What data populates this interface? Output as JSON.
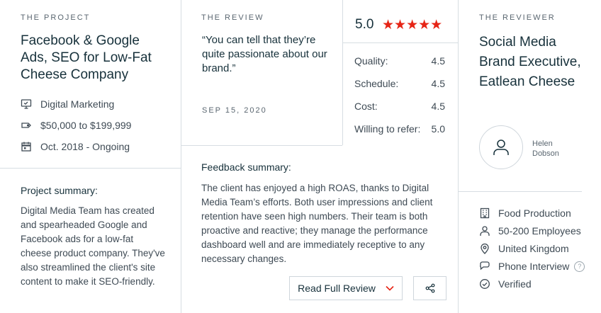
{
  "project": {
    "header": "THE PROJECT",
    "title": "Facebook & Google Ads, SEO for Low-Fat Cheese Company",
    "meta": [
      {
        "icon": "presentation-icon",
        "text": "Digital Marketing"
      },
      {
        "icon": "price-tag-icon",
        "text": "$50,000 to $199,999"
      },
      {
        "icon": "calendar-icon",
        "text": "Oct. 2018 - Ongoing"
      }
    ],
    "summary_title": "Project summary:",
    "summary": "Digital Media Team has created and spearheaded Google and Facebook ads for a low-fat cheese product company. They've also streamlined the client's site content to make it SEO-friendly."
  },
  "review": {
    "header": "THE REVIEW",
    "quote": "“You can tell that they’re quite passionate about our brand.”",
    "date": "SEP 15, 2020",
    "overall": "5.0",
    "stars": "★★★★★",
    "ratings": [
      {
        "label": "Quality:",
        "value": "4.5"
      },
      {
        "label": "Schedule:",
        "value": "4.5"
      },
      {
        "label": "Cost:",
        "value": "4.5"
      },
      {
        "label": "Willing to refer:",
        "value": "5.0"
      }
    ],
    "feedback_title": "Feedback summary:",
    "feedback": "The client has enjoyed a high ROAS, thanks to Digital Media Team’s efforts. Both user impressions and client retention have seen high numbers. Their team is both proactive and reactive; they manage the performance dashboard well and are immediately receptive to any necessary changes.",
    "read_full_label": "Read Full Review"
  },
  "reviewer": {
    "header": "THE REVIEWER",
    "title": "Social Media Brand Executive, Eatlean Cheese",
    "first_name": "Helen",
    "last_name": "Dobson",
    "facts": [
      {
        "icon": "building-icon",
        "text": "Food Production"
      },
      {
        "icon": "person-icon",
        "text": "50-200 Employees"
      },
      {
        "icon": "location-pin-icon",
        "text": "United Kingdom"
      },
      {
        "icon": "chat-bubble-icon",
        "text": "Phone Interview",
        "help": "?"
      },
      {
        "icon": "check-circle-icon",
        "text": "Verified"
      }
    ]
  },
  "colors": {
    "accent": "#e62415",
    "text": "#17313b",
    "border": "#d7dde2"
  }
}
